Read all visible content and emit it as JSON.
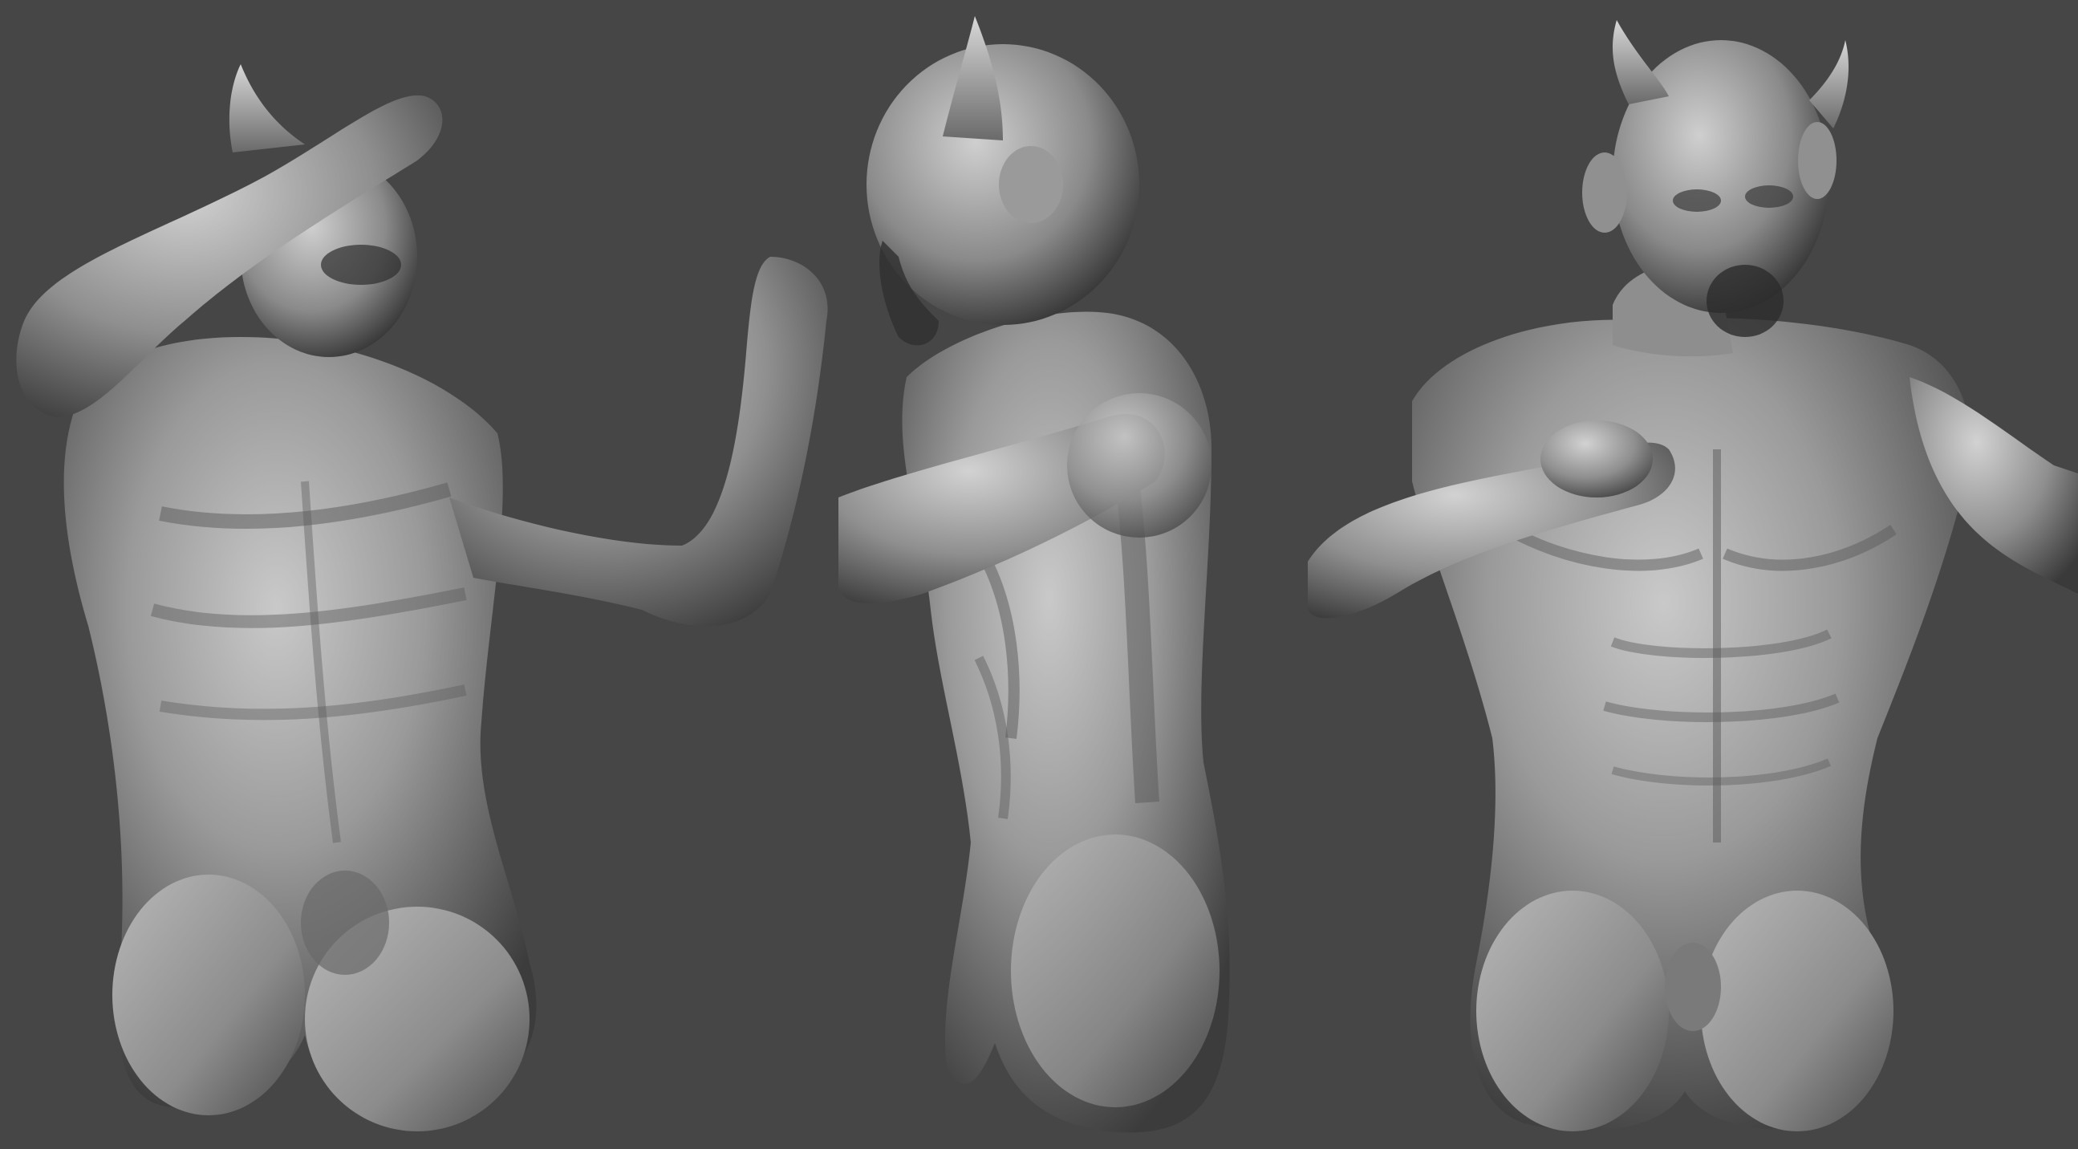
{
  "scene": {
    "background_color": "#464646",
    "material_color": "#9a9a9a",
    "views": [
      {
        "name": "three-quarter-view"
      },
      {
        "name": "side-view"
      },
      {
        "name": "front-view"
      }
    ]
  }
}
